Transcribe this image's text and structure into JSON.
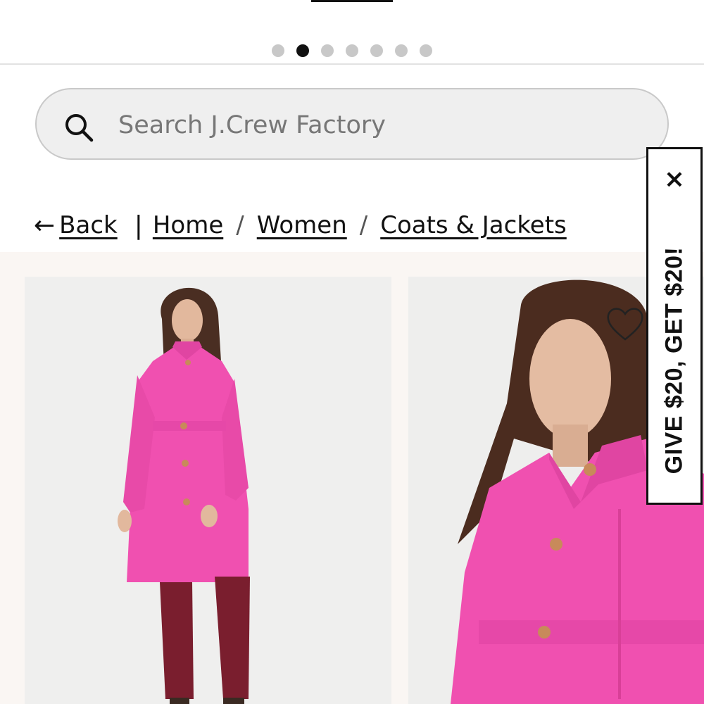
{
  "carousel": {
    "dot_count": 7,
    "active_index": 1
  },
  "search": {
    "placeholder": "Search J.Crew Factory",
    "icon": "search-icon"
  },
  "breadcrumb": {
    "back_label": "Back",
    "items": [
      "Home",
      "Women",
      "Coats & Jackets"
    ],
    "separator": "/"
  },
  "promo": {
    "text": "GIVE $20, GET $20!",
    "close_label": "×"
  },
  "products": [
    {
      "image": "product-photo-pink-coat-full-length",
      "favorite_icon": "heart-icon"
    },
    {
      "image": "product-photo-pink-coat-closeup"
    }
  ],
  "colors": {
    "coat_pink": "#f050b0",
    "pants": "#7a1e2e",
    "page_bg": "#faf6f3"
  }
}
